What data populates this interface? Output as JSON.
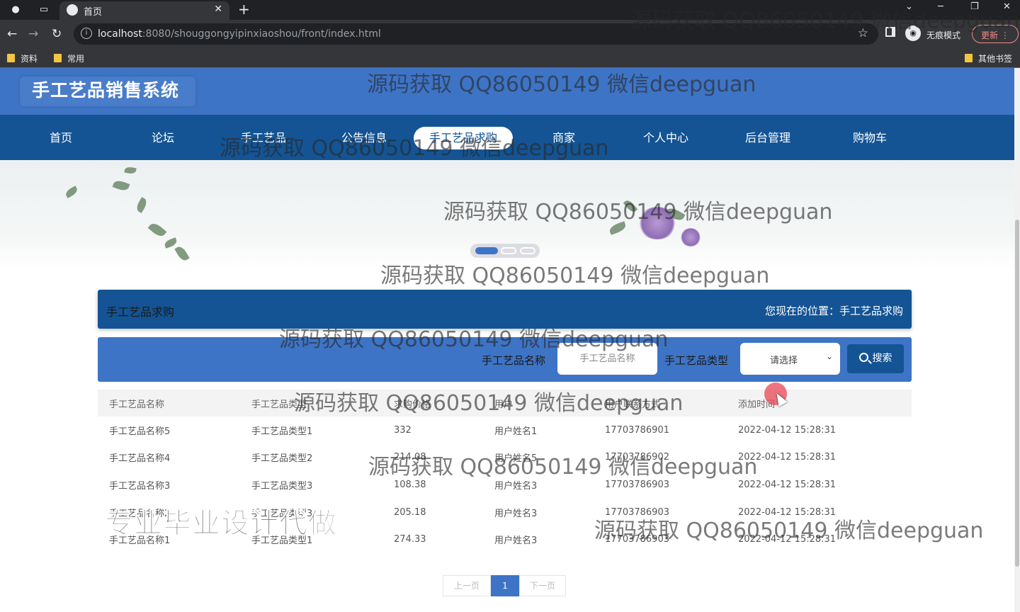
{
  "browser": {
    "tab_title": "首页",
    "url_host": "localhost",
    "url_rest": ":8080/shouggongyipinxiaoshou/front/index.html",
    "incognito_label": "无痕模式",
    "update_label": "更新",
    "bookmarks": [
      "资料",
      "常用"
    ],
    "other_bookmarks": "其他书签"
  },
  "site": {
    "title": "手工艺品销售系统"
  },
  "nav": [
    "首页",
    "论坛",
    "手工艺品",
    "公告信息",
    "手工艺品求购",
    "商家",
    "个人中心",
    "后台管理",
    "购物车"
  ],
  "location": {
    "title": "手工艺品求购",
    "path": "您现在的位置：手工艺品求购"
  },
  "search": {
    "name_label": "手工艺品名称",
    "name_placeholder": "手工艺品名称",
    "type_label": "手工艺品类型",
    "type_value": "请选择",
    "button": "搜索"
  },
  "table": {
    "headers": [
      "手工艺品名称",
      "手工艺品类型",
      "求购价格",
      "用户",
      "用户联系方式",
      "添加时间"
    ],
    "rows": [
      [
        "手工艺品名称5",
        "手工艺品类型1",
        "332",
        "用户姓名1",
        "17703786901",
        "2022-04-12 15:28:31"
      ],
      [
        "手工艺品名称4",
        "手工艺品类型2",
        "214.08",
        "用户姓名5",
        "17703786902",
        "2022-04-12 15:28:31"
      ],
      [
        "手工艺品名称3",
        "手工艺品类型3",
        "108.38",
        "用户姓名3",
        "17703786903",
        "2022-04-12 15:28:31"
      ],
      [
        "手工艺品名称2",
        "手工艺品类型3",
        "205.18",
        "用户姓名3",
        "17703786903",
        "2022-04-12 15:28:31"
      ],
      [
        "手工艺品名称1",
        "手工艺品类型1",
        "274.33",
        "用户姓名3",
        "17703786903",
        "2022-04-12 15:28:31"
      ]
    ]
  },
  "pager": {
    "prev": "上一页",
    "current": "1",
    "next": "下一页"
  },
  "watermark": "源码获取 QQ86050149 微信deepguan",
  "promo": "专业毕业设计代做",
  "colors": {
    "header_blue": "#3e74c6",
    "nav_dark_blue": "#145494"
  }
}
